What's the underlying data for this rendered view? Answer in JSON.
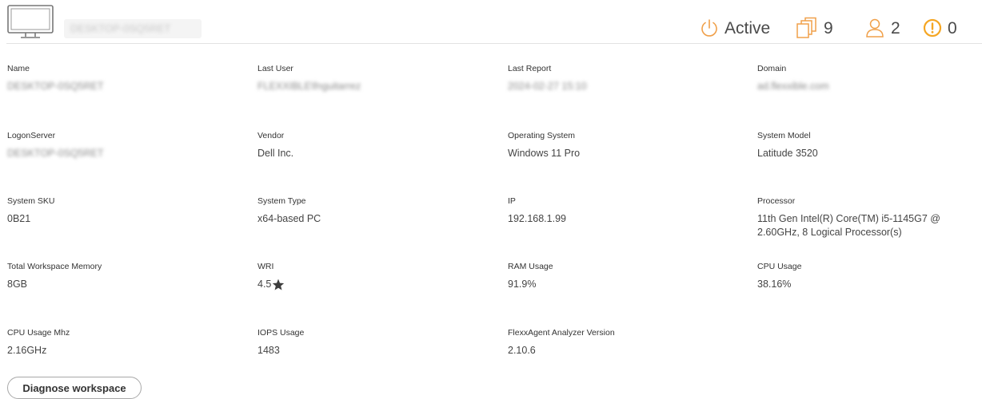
{
  "header": {
    "hostname": "DESKTOP-0SQ5RET",
    "status_label": "Active",
    "sessions_count": "9",
    "users_count": "2",
    "alerts_count": "0"
  },
  "fields": {
    "name": {
      "label": "Name",
      "value": "DESKTOP-0SQ5RET"
    },
    "last_user": {
      "label": "Last User",
      "value": "FLEXXIBLE\\fnguitarrez"
    },
    "last_report": {
      "label": "Last Report",
      "value": "2024-02-27 15:10"
    },
    "domain": {
      "label": "Domain",
      "value": "ad.flexxible.com"
    },
    "logon_server": {
      "label": "LogonServer",
      "value": "DESKTOP-0SQ5RET"
    },
    "vendor": {
      "label": "Vendor",
      "value": "Dell Inc."
    },
    "operating_system": {
      "label": "Operating System",
      "value": "Windows 11 Pro"
    },
    "system_model": {
      "label": "System Model",
      "value": "Latitude 3520"
    },
    "system_sku": {
      "label": "System SKU",
      "value": "0B21"
    },
    "system_type": {
      "label": "System Type",
      "value": "x64-based PC"
    },
    "ip": {
      "label": "IP",
      "value": "192.168.1.99"
    },
    "processor": {
      "label": "Processor",
      "value": "11th Gen Intel(R) Core(TM) i5-1145G7 @ 2.60GHz, 8 Logical Processor(s)"
    },
    "total_workspace_memory": {
      "label": "Total Workspace Memory",
      "value": "8GB"
    },
    "wri": {
      "label": "WRI",
      "value": "4.5"
    },
    "ram_usage": {
      "label": "RAM Usage",
      "value": "91.9%"
    },
    "cpu_usage": {
      "label": "CPU Usage",
      "value": "38.16%"
    },
    "cpu_usage_mhz": {
      "label": "CPU Usage Mhz",
      "value": "2.16GHz"
    },
    "iops_usage": {
      "label": "IOPS Usage",
      "value": "1483"
    },
    "agent_version": {
      "label": "FlexxAgent Analyzer Version",
      "value": "2.10.6"
    }
  },
  "actions": {
    "diagnose_label": "Diagnose workspace"
  },
  "icons": {
    "monitor": "monitor-icon",
    "power": "power-icon",
    "sessions": "sessions-stack-icon",
    "users": "user-icon",
    "alerts": "alert-circle-icon",
    "wri": "star-icon"
  },
  "colors": {
    "accent_orange": "#f0a04a",
    "alert_orange": "#f5a623",
    "text": "#333333"
  }
}
